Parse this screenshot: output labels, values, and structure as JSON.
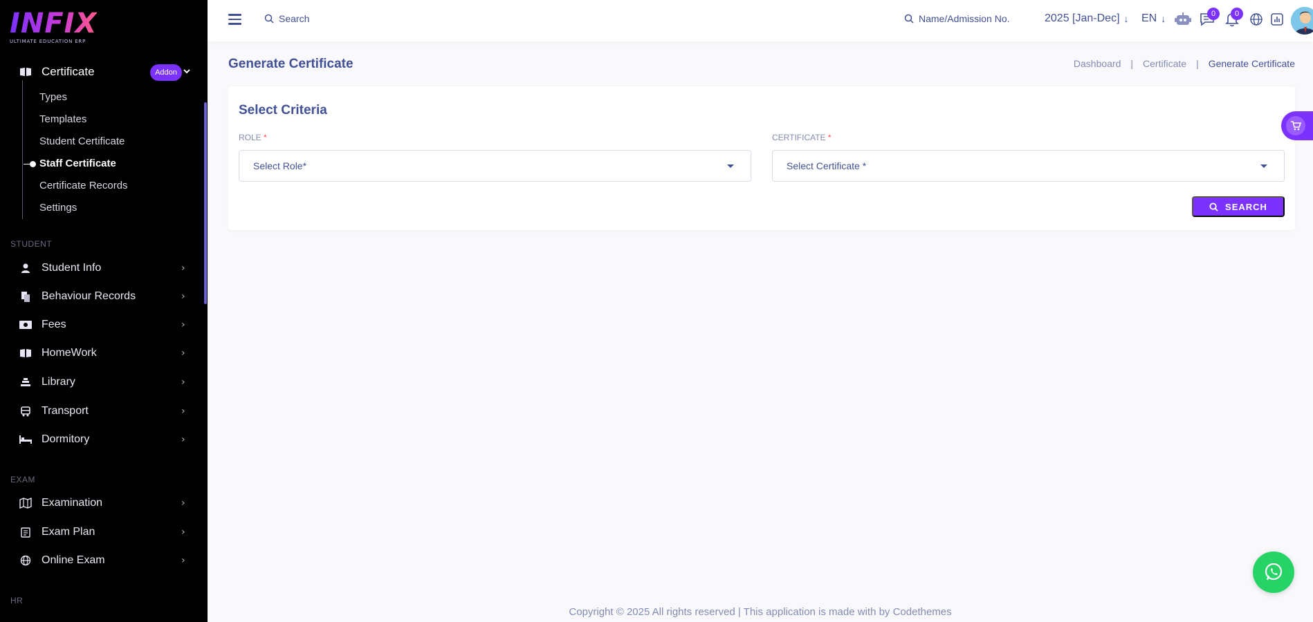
{
  "brand": {
    "logo_text": "INFIX",
    "tagline": "ULTIMATE EDUCATION ERP"
  },
  "sidebar": {
    "certificate": {
      "label": "Certificate",
      "badge": "Addon"
    },
    "certificate_items": [
      {
        "label": "Types"
      },
      {
        "label": "Templates"
      },
      {
        "label": "Student Certificate"
      },
      {
        "label": "Staff Certificate"
      },
      {
        "label": "Certificate Records"
      },
      {
        "label": "Settings"
      }
    ],
    "sections": [
      {
        "title": "STUDENT"
      },
      {
        "title": "EXAM"
      },
      {
        "title": "HR"
      }
    ],
    "student_items": [
      {
        "label": "Student Info",
        "icon": "student-icon"
      },
      {
        "label": "Behaviour Records",
        "icon": "records-icon"
      },
      {
        "label": "Fees",
        "icon": "money-icon"
      },
      {
        "label": "HomeWork",
        "icon": "book-icon"
      },
      {
        "label": "Library",
        "icon": "library-icon"
      },
      {
        "label": "Transport",
        "icon": "bus-icon"
      },
      {
        "label": "Dormitory",
        "icon": "bed-icon"
      }
    ],
    "exam_items": [
      {
        "label": "Examination",
        "icon": "map-icon"
      },
      {
        "label": "Exam Plan",
        "icon": "clipboard-icon"
      },
      {
        "label": "Online Exam",
        "icon": "globe-icon"
      }
    ]
  },
  "header": {
    "search_label": "Search",
    "student_search_label": "Name/Admission No.",
    "academic_year": "2025 [Jan-Dec]",
    "language": "EN",
    "chat_count": "0",
    "notification_count": "0"
  },
  "page": {
    "title": "Generate Certificate",
    "breadcrumb": [
      "Dashboard",
      "Certificate",
      "Generate Certificate"
    ]
  },
  "criteria": {
    "title": "Select Criteria",
    "role_label": "ROLE",
    "role_placeholder": "Select Role*",
    "certificate_label": "CERTIFICATE",
    "certificate_placeholder": "Select Certificate *",
    "required_mark": "*",
    "search_button": "SEARCH"
  },
  "footer": {
    "text": "Copyright © 2025 All rights reserved | This application is made with by Codethemes"
  },
  "colors": {
    "accent": "#7c32ff",
    "text": "#415094",
    "muted": "#828bb2",
    "sidebar_bg": "#000000",
    "whatsapp": "#25d366"
  }
}
